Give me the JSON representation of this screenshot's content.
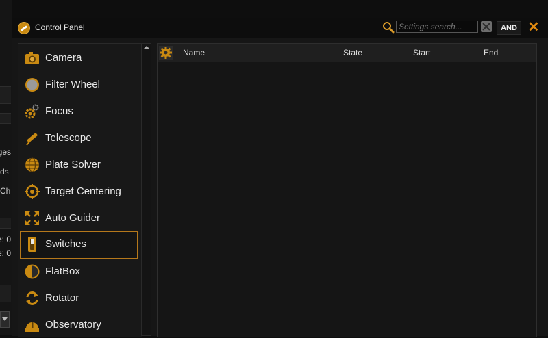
{
  "background_app": {
    "fragments": [
      "ges",
      "ds",
      "Ch",
      "e: 0",
      "e: 0"
    ]
  },
  "window": {
    "title": "Control Panel",
    "search": {
      "placeholder": "Settings search..."
    },
    "and_label": "AND",
    "close_glyph": "✕"
  },
  "sidebar": {
    "items": [
      {
        "label": "Camera",
        "icon": "camera-icon"
      },
      {
        "label": "Filter Wheel",
        "icon": "filter-wheel-icon"
      },
      {
        "label": "Focus",
        "icon": "focus-gears-icon"
      },
      {
        "label": "Telescope",
        "icon": "telescope-icon"
      },
      {
        "label": "Plate Solver",
        "icon": "globe-icon"
      },
      {
        "label": "Target Centering",
        "icon": "crosshair-icon"
      },
      {
        "label": "Auto Guider",
        "icon": "expand-arrows-icon"
      },
      {
        "label": "Switches",
        "icon": "switch-icon",
        "selected": true
      },
      {
        "label": "FlatBox",
        "icon": "half-circle-icon"
      },
      {
        "label": "Rotator",
        "icon": "rotate-icon"
      },
      {
        "label": "Observatory",
        "icon": "dome-icon"
      }
    ]
  },
  "table": {
    "columns": [
      "Name",
      "State",
      "Start",
      "End"
    ],
    "rows": []
  },
  "colors": {
    "accent": "#c98a12",
    "background": "#161616"
  }
}
